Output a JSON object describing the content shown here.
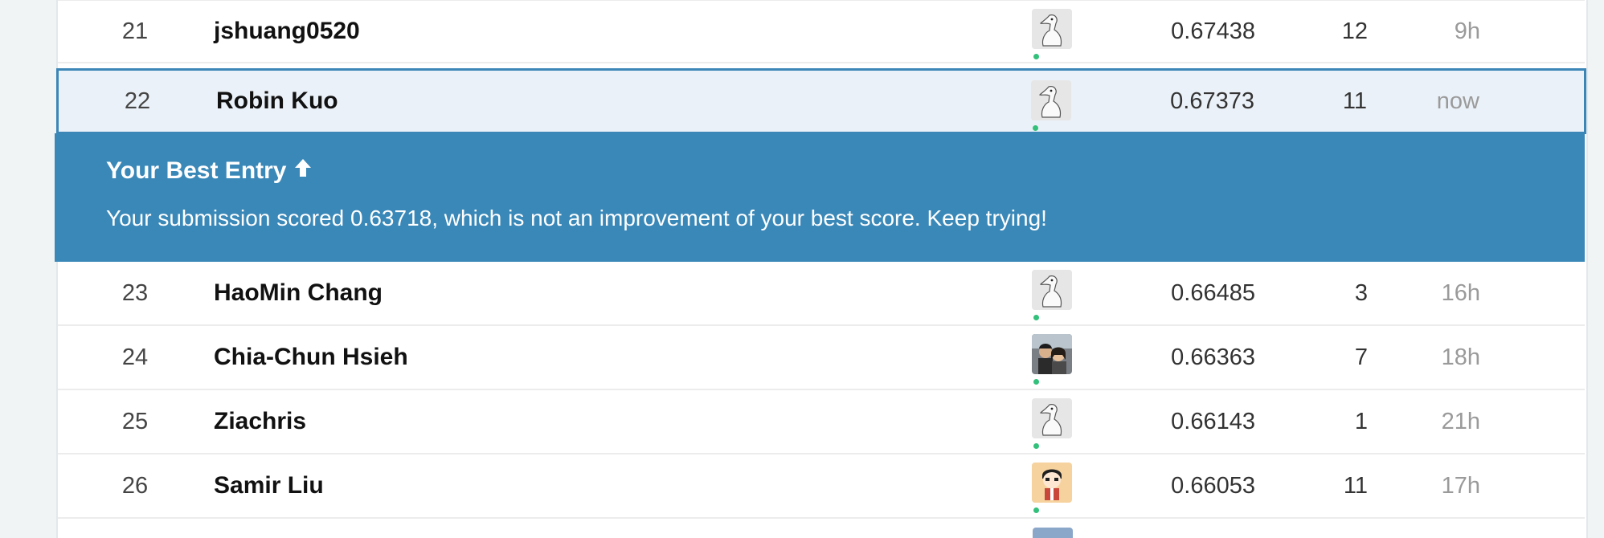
{
  "colors": {
    "banner_bg": "#3a88b8",
    "highlight_bg": "#ebf1f8",
    "highlight_border": "#3b86b7",
    "online_dot": "#32c07a"
  },
  "rows_above": [
    {
      "rank": "21",
      "name": "jshuang0520",
      "avatar": "goose-default-avatar",
      "score": "0.67438",
      "entries": "12",
      "last": "9h"
    }
  ],
  "current_row": {
    "rank": "22",
    "name": "Robin Kuo",
    "avatar": "goose-default-avatar",
    "score": "0.67373",
    "entries": "11",
    "last": "now"
  },
  "banner": {
    "title": "Your Best Entry",
    "title_icon": "arrow-up-icon",
    "message": "Your submission scored 0.63718, which is not an improvement of your best score. Keep trying!"
  },
  "rows_below": [
    {
      "rank": "23",
      "name": "HaoMin Chang",
      "avatar": "goose-default-avatar",
      "score": "0.66485",
      "entries": "3",
      "last": "16h"
    },
    {
      "rank": "24",
      "name": "Chia-Chun Hsieh",
      "avatar": "photo-avatar",
      "score": "0.66363",
      "entries": "7",
      "last": "18h"
    },
    {
      "rank": "25",
      "name": "Ziachris",
      "avatar": "goose-default-avatar",
      "score": "0.66143",
      "entries": "1",
      "last": "21h"
    },
    {
      "rank": "26",
      "name": "Samir Liu",
      "avatar": "cartoon-avatar",
      "score": "0.66053",
      "entries": "11",
      "last": "17h"
    }
  ]
}
